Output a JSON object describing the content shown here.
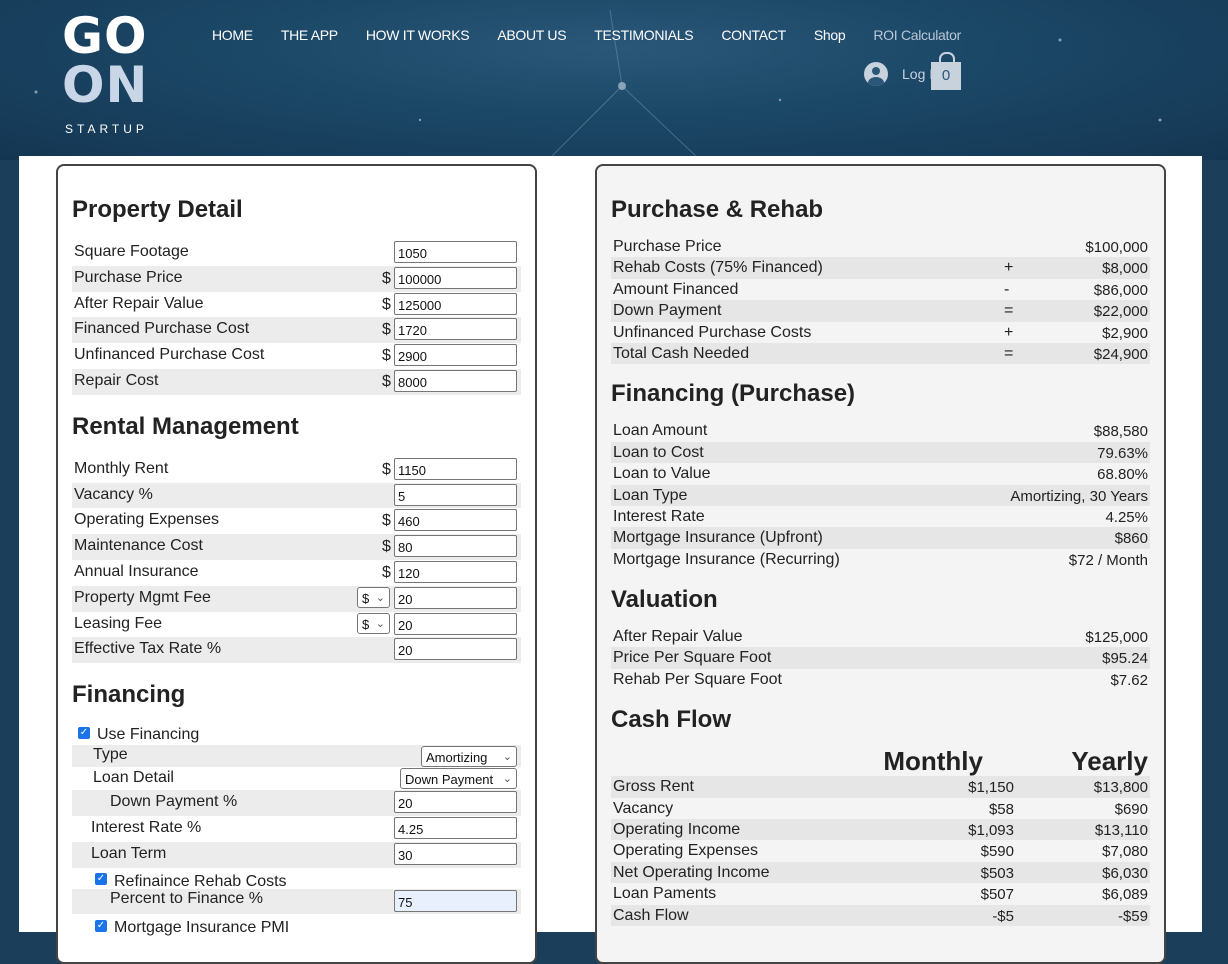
{
  "header": {
    "logo": {
      "line1": "GO",
      "line2": "ON",
      "tagline": "STARTUP"
    },
    "nav": [
      "HOME",
      "THE APP",
      "HOW IT WORKS",
      "ABOUT US",
      "TESTIMONIALS",
      "CONTACT",
      "Shop",
      "ROI Calculator"
    ],
    "login_label": "Log I",
    "cart_count": "0"
  },
  "property_detail": {
    "title": "Property Detail",
    "rows": [
      {
        "label": "Square Footage",
        "prefix": "",
        "value": "1050"
      },
      {
        "label": "Purchase Price",
        "prefix": "$",
        "value": "100000"
      },
      {
        "label": "After Repair Value",
        "prefix": "$",
        "value": "125000"
      },
      {
        "label": "Financed Purchase Cost",
        "prefix": "$",
        "value": "1720"
      },
      {
        "label": "Unfinanced Purchase Cost",
        "prefix": "$",
        "value": "2900"
      },
      {
        "label": "Repair Cost",
        "prefix": "$",
        "value": "8000"
      }
    ]
  },
  "rental_management": {
    "title": "Rental Management",
    "rows": [
      {
        "label": "Monthly Rent",
        "prefix": "$",
        "value": "1150"
      },
      {
        "label": "Vacancy %",
        "prefix": "",
        "value": "5"
      },
      {
        "label": "Operating Expenses",
        "prefix": "$",
        "value": "460"
      },
      {
        "label": "Maintenance Cost",
        "prefix": "$",
        "value": "80"
      },
      {
        "label": "Annual Insurance",
        "prefix": "$",
        "value": "120"
      },
      {
        "label": "Property Mgmt Fee",
        "select": "$",
        "value": "20"
      },
      {
        "label": "Leasing Fee",
        "select": "$",
        "value": "20"
      },
      {
        "label": "Effective Tax Rate %",
        "prefix": "",
        "value": "20"
      }
    ]
  },
  "financing_inputs": {
    "title": "Financing",
    "use_financing": "Use Financing",
    "type_label": "Type",
    "type_value": "Amortizing",
    "loan_detail_label": "Loan Detail",
    "loan_detail_value": "Down Payment",
    "down_payment_label": "Down Payment %",
    "down_payment_value": "20",
    "interest_label": "Interest Rate %",
    "interest_value": "4.25",
    "term_label": "Loan Term",
    "term_value": "30",
    "refinance_label": "Refinaince Rehab Costs",
    "percent_label": "Percent to Finance %",
    "percent_value": "75",
    "pmi_label": "Mortgage Insurance PMI"
  },
  "purchase_rehab": {
    "title": "Purchase & Rehab",
    "rows": [
      {
        "label": "Purchase Price",
        "op": "",
        "value": "$100,000"
      },
      {
        "label": "Rehab Costs (75% Financed)",
        "op": "+",
        "value": "$8,000"
      },
      {
        "label": "Amount Financed",
        "op": "-",
        "value": "$86,000"
      },
      {
        "label": "Down Payment",
        "op": "=",
        "value": "$22,000"
      },
      {
        "label": "Unfinanced Purchase Costs",
        "op": "+",
        "value": "$2,900"
      },
      {
        "label": "Total Cash Needed",
        "op": "=",
        "value": "$24,900"
      }
    ]
  },
  "financing_purchase": {
    "title": "Financing (Purchase)",
    "rows": [
      {
        "label": "Loan Amount",
        "value": "$88,580"
      },
      {
        "label": "Loan to Cost",
        "value": "79.63%"
      },
      {
        "label": "Loan to Value",
        "value": "68.80%"
      },
      {
        "label": "Loan Type",
        "value": "Amortizing, 30 Years"
      },
      {
        "label": "Interest Rate",
        "value": "4.25%"
      },
      {
        "label": "Mortgage Insurance (Upfront)",
        "value": "$860"
      },
      {
        "label": "Mortgage Insurance (Recurring)",
        "value": "$72 / Month"
      }
    ]
  },
  "valuation": {
    "title": "Valuation",
    "rows": [
      {
        "label": "After Repair Value",
        "value": "$125,000"
      },
      {
        "label": "Price Per Square Foot",
        "value": "$95.24"
      },
      {
        "label": "Rehab Per Square Foot",
        "value": "$7.62"
      }
    ]
  },
  "cash_flow": {
    "title": "Cash Flow",
    "monthly_header": "Monthly",
    "yearly_header": "Yearly",
    "rows": [
      {
        "label": "Gross Rent",
        "monthly": "$1,150",
        "yearly": "$13,800"
      },
      {
        "label": "Vacancy",
        "monthly": "$58",
        "yearly": "$690"
      },
      {
        "label": "Operating Income",
        "monthly": "$1,093",
        "yearly": "$13,110"
      },
      {
        "label": "Operating Expenses",
        "monthly": "$590",
        "yearly": "$7,080"
      },
      {
        "label": "Net Operating Income",
        "monthly": "$503",
        "yearly": "$6,030"
      },
      {
        "label": "Loan Paments",
        "monthly": "$507",
        "yearly": "$6,089"
      },
      {
        "label": "Cash Flow",
        "monthly": "-$5",
        "yearly": "-$59"
      }
    ]
  }
}
